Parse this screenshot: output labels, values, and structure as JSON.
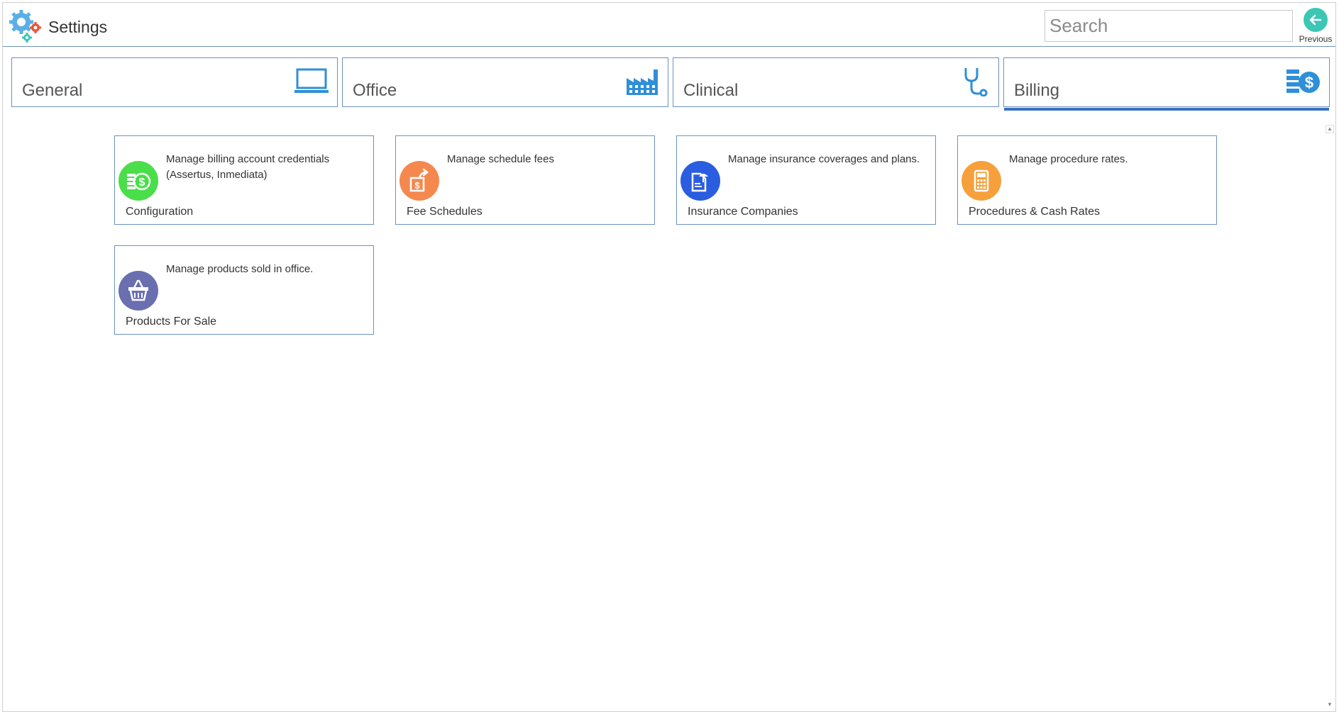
{
  "header": {
    "title": "Settings",
    "search_placeholder": "Search",
    "previous_label": "Previous"
  },
  "tabs": [
    {
      "label": "General",
      "icon": "monitor-icon"
    },
    {
      "label": "Office",
      "icon": "factory-icon"
    },
    {
      "label": "Clinical",
      "icon": "stethoscope-icon"
    },
    {
      "label": "Billing",
      "icon": "billing-dollar-icon",
      "active": true
    }
  ],
  "cards": [
    {
      "title": "Configuration",
      "description": "Manage billing account credentials (Assertus, Inmediata)",
      "icon": "billing-config-icon",
      "color": "#4ade4a"
    },
    {
      "title": "Fee Schedules",
      "description": "Manage schedule fees",
      "icon": "fee-schedule-icon",
      "color": "#f5884f"
    },
    {
      "title": "Insurance Companies",
      "description": "Manage insurance coverages and plans.",
      "icon": "insurance-document-icon",
      "color": "#2a5de0"
    },
    {
      "title": "Procedures & Cash Rates",
      "description": "Manage procedure rates.",
      "icon": "calculator-icon",
      "color": "#f6a03c"
    },
    {
      "title": "Products For Sale",
      "description": "Manage products sold in office.",
      "icon": "basket-icon",
      "color": "#6a6fb0"
    }
  ],
  "colors": {
    "accent": "#3a6fbf",
    "border": "#6b93c0",
    "icon_blue": "#2f8fd8"
  }
}
